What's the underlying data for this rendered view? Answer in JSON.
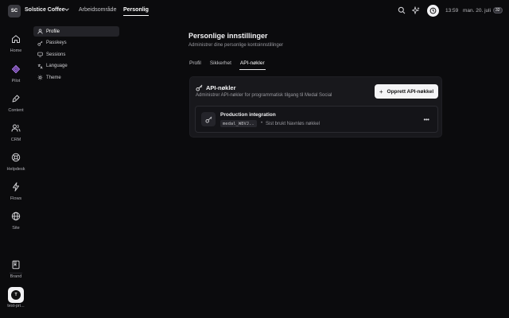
{
  "workspace": {
    "initials": "SC",
    "name": "Solstice Coffee"
  },
  "nav_tabs": {
    "workspace": "Arbeidsområde",
    "personal": "Personlig"
  },
  "topbar": {
    "time": "13:59",
    "date": "man. 20. juli",
    "notification_count": "32"
  },
  "rail": {
    "items": [
      "Home",
      "Pilot",
      "Content",
      "CRM",
      "Helpdesk",
      "Flows",
      "Site"
    ],
    "brand": "Brand",
    "user_initial": "T",
    "user_label": "test-pri..."
  },
  "settings_nav": {
    "items": [
      "Profile",
      "Passkeys",
      "Sessions",
      "Language",
      "Theme"
    ]
  },
  "page": {
    "title": "Personlige innstillinger",
    "subtitle": "Administrer dine personlige kontoinnstillinger",
    "tabs": [
      "Profil",
      "Sikkerhet",
      "API-nøkler"
    ]
  },
  "api_keys": {
    "title": "API-nøkler",
    "description": "Administrer API-nøkler for programmatisk tilgang til Medal Social",
    "create_button": "Opprett API-nøkkel",
    "create_plus": "+",
    "keys": [
      {
        "name": "Production integration",
        "prefix": "medal_W8VJ..",
        "separator": "•",
        "meta": "Sist brukt Navnløs nøkkel",
        "more": "•••"
      }
    ]
  },
  "colors": {
    "background": "#0b0b0d",
    "card": "#18181c",
    "accent_pilot": "#b07cf0"
  }
}
